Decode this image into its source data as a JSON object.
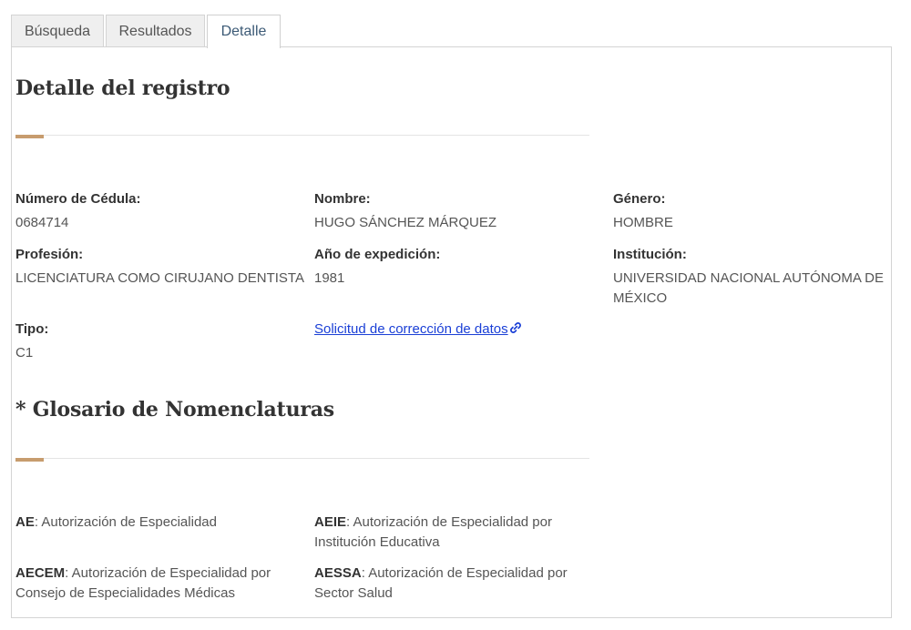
{
  "tabs": [
    {
      "label": "Búsqueda"
    },
    {
      "label": "Resultados"
    },
    {
      "label": "Detalle"
    }
  ],
  "detail": {
    "title": "Detalle del registro",
    "fields": {
      "cedula": {
        "label": "Número de Cédula:",
        "value": "0684714"
      },
      "nombre": {
        "label": "Nombre:",
        "value": "HUGO SÁNCHEZ MÁRQUEZ"
      },
      "genero": {
        "label": "Género:",
        "value": "HOMBRE"
      },
      "profesion": {
        "label": "Profesión:",
        "value": "LICENCIATURA COMO CIRUJANO DENTISTA"
      },
      "anio": {
        "label": "Año de expedición:",
        "value": "1981"
      },
      "institucion": {
        "label": "Institución:",
        "value": "UNIVERSIDAD NACIONAL AUTÓNOMA DE MÉXICO"
      },
      "tipo": {
        "label": "Tipo:",
        "value": "C1"
      }
    },
    "correction_link": "Solicitud de corrección de datos"
  },
  "glossary": {
    "title": "* Glosario de Nomenclaturas",
    "items": [
      {
        "code": "AE",
        "text": ": Autorización de Especialidad"
      },
      {
        "code": "AEIE",
        "text": ": Autorización de Especialidad por Institución Educativa"
      },
      {
        "code": "AECEM",
        "text": ": Autorización de Especialidad por Consejo de Especialidades Médicas"
      },
      {
        "code": "AESSA",
        "text": ": Autorización de Especialidad por Sector Salud"
      }
    ]
  },
  "colors": {
    "accent": "#c79c6e",
    "link": "#1a3fd6",
    "active_tab_text": "#3c5a76"
  },
  "icons": {
    "link": "link-icon"
  }
}
